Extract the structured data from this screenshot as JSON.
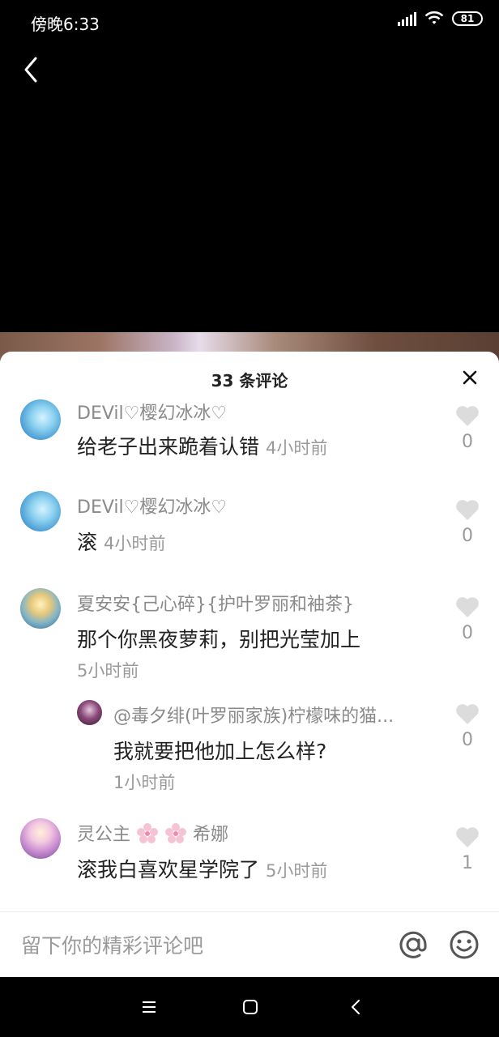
{
  "status_bar": {
    "time": "傍晚6:33",
    "battery": "81"
  },
  "sheet": {
    "title": "33 条评论"
  },
  "comments": [
    {
      "username": "DEVil♡樱幻冰冰♡",
      "text": "给老子出来跪着认错",
      "time": "4小时前",
      "likes": "0"
    },
    {
      "username": "DEVil♡樱幻冰冰♡",
      "text": "滚",
      "time": "4小时前",
      "likes": "0"
    },
    {
      "username": "夏安安{己心碎}{护叶罗丽和袖茶}",
      "text": "那个你黑夜萝莉，别把光莹加上",
      "time": "5小时前",
      "likes": "0"
    },
    {
      "username": "@毒夕绯(叶罗丽家族)柠檬味的猫...",
      "text": "我就要把他加上怎么样?",
      "time": "1小时前",
      "likes": "0"
    },
    {
      "username_parts": [
        "灵公主",
        "希娜"
      ],
      "text": "滚我白喜欢星学院了",
      "time": "5小时前",
      "likes": "1"
    }
  ],
  "input": {
    "placeholder": "留下你的精彩评论吧"
  },
  "icons": {
    "back": "chevron-left-icon",
    "close": "close-icon",
    "like": "heart-icon",
    "mention": "at-icon",
    "emoji": "smiley-icon",
    "nav_menu": "menu-icon",
    "nav_home": "square-icon",
    "nav_back": "triangle-back-icon"
  },
  "colors": {
    "like_icon": "#dcdcdc",
    "secondary_text": "#8a8a8a",
    "sheet_bg": "#ffffff"
  }
}
